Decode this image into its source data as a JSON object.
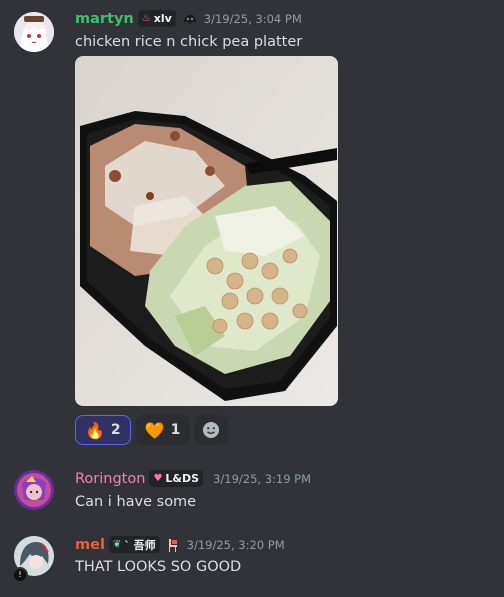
{
  "messages": [
    {
      "username": "martyn",
      "user_color": "#3fbf6e",
      "tag": "xlv",
      "timestamp": "3/19/25, 3:04 PM",
      "text": "chicken rice n chick pea platter",
      "image_alt": "chicken rice and chickpea salad platter in a black takeout container",
      "reactions": [
        {
          "emoji": "🔥",
          "count": "2",
          "selected": true
        },
        {
          "emoji": "🧡",
          "count": "1",
          "selected": false
        }
      ]
    },
    {
      "username": "Rorington",
      "user_color": "#f47fb4",
      "tag": "L&DS",
      "timestamp": "3/19/25, 3:19 PM",
      "text": "Can i have some"
    },
    {
      "username": "mel",
      "user_color": "#e8603a",
      "tag": "` 吾师",
      "timestamp": "3/19/25, 3:20 PM",
      "text": "THAT LOOKS SO GOOD"
    }
  ]
}
